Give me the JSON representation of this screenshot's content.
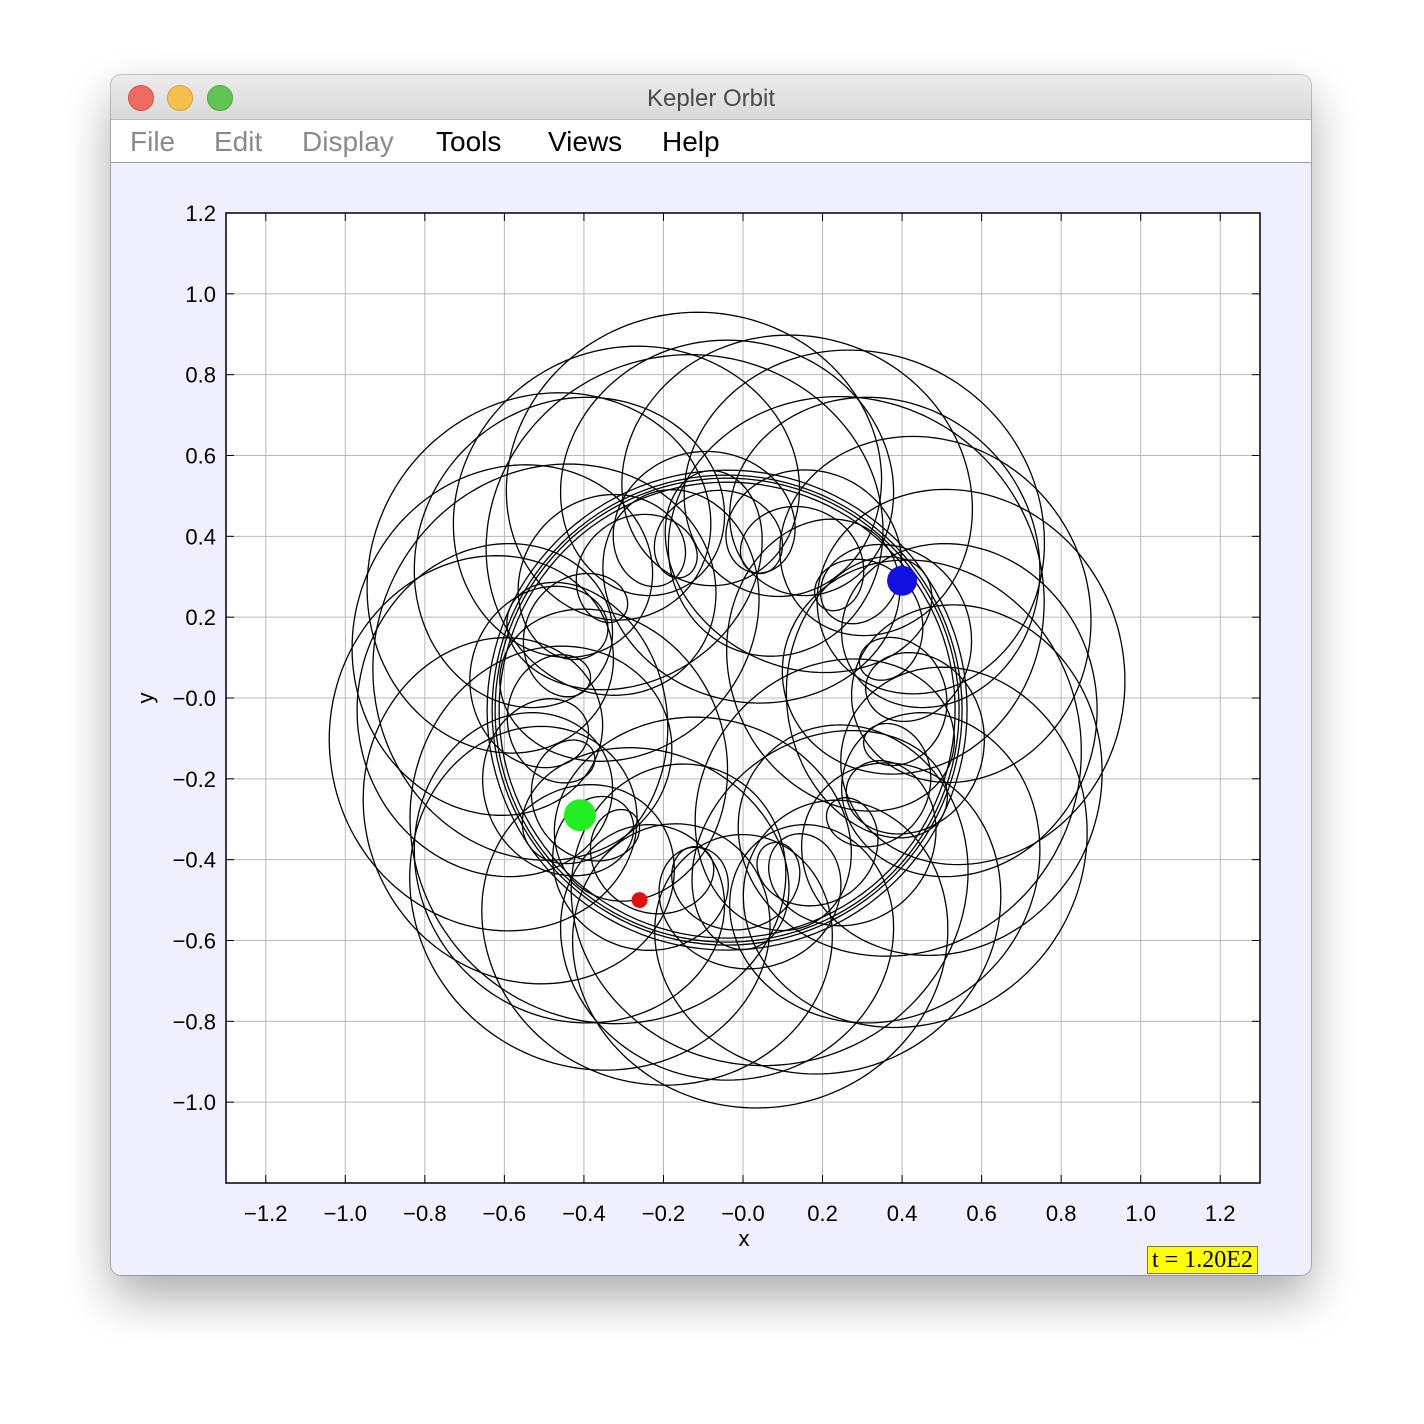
{
  "window": {
    "title": "Kepler Orbit"
  },
  "menu": [
    {
      "label": "File",
      "enabled": false
    },
    {
      "label": "Edit",
      "enabled": false
    },
    {
      "label": "Display",
      "enabled": false
    },
    {
      "label": "Tools",
      "enabled": true
    },
    {
      "label": "Views",
      "enabled": true
    },
    {
      "label": "Help",
      "enabled": true
    }
  ],
  "readout": {
    "time": "t = 1.20E2"
  },
  "chart_data": {
    "type": "scatter",
    "xlabel": "x",
    "ylabel": "y",
    "xlim": [
      -1.3,
      1.3
    ],
    "ylim": [
      -1.2,
      1.2
    ],
    "grid": true,
    "x_ticks": [
      "−1.2",
      "−1.0",
      "−0.8",
      "−0.6",
      "−0.4",
      "−0.2",
      "−0.0",
      "0.2",
      "0.4",
      "0.6",
      "0.8",
      "1.0",
      "1.2"
    ],
    "y_ticks": [
      "1.2",
      "1.0",
      "0.8",
      "0.6",
      "0.4",
      "0.2",
      "−0.0",
      "−0.2",
      "−0.4",
      "−0.6",
      "−0.8",
      "−1.0"
    ],
    "bodies": [
      {
        "name": "blue",
        "x": 0.4,
        "y": 0.29,
        "color": "#1010e0"
      },
      {
        "name": "green",
        "x": -0.41,
        "y": -0.29,
        "color": "#22ee22"
      },
      {
        "name": "red",
        "x": -0.26,
        "y": -0.5,
        "color": "#e01010"
      }
    ],
    "trail_color": "#000000"
  }
}
